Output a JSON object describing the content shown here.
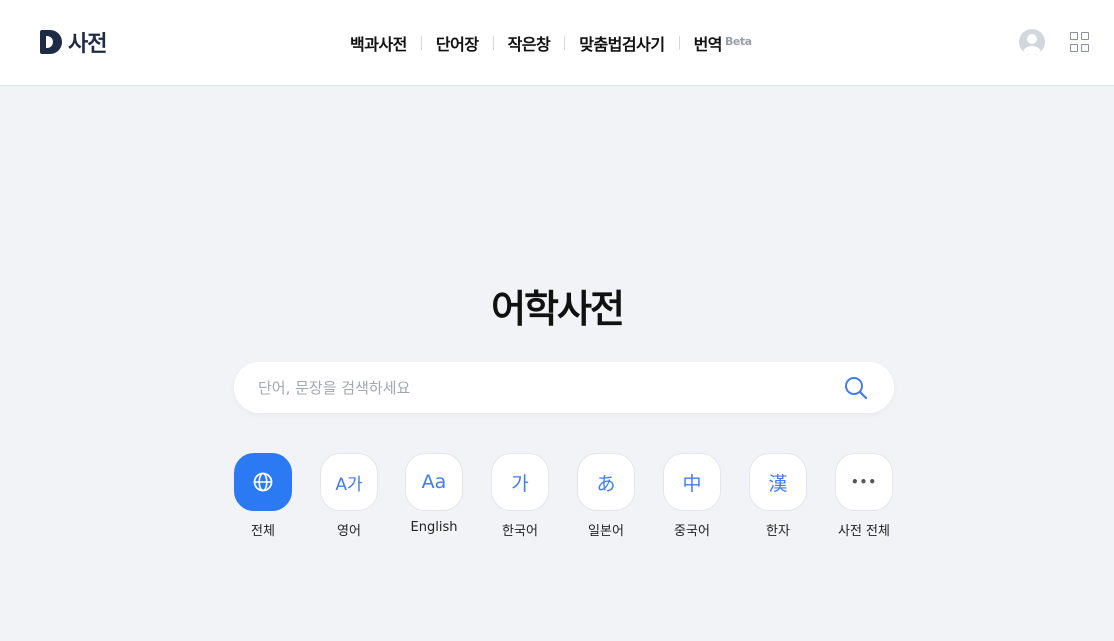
{
  "header": {
    "logo_text": "사전",
    "nav": [
      {
        "label": "백과사전"
      },
      {
        "label": "단어장"
      },
      {
        "label": "작은창"
      },
      {
        "label": "맞춤법검사기"
      },
      {
        "label": "번역",
        "badge": "Beta"
      }
    ]
  },
  "main": {
    "title": "어학사전",
    "search": {
      "placeholder": "단어, 문장을 검색하세요",
      "value": ""
    },
    "categories": [
      {
        "icon": "globe-icon",
        "glyph": "",
        "label": "전체",
        "active": true
      },
      {
        "icon": "english-translate-icon",
        "glyph": "A가",
        "label": "영어"
      },
      {
        "icon": "english-aa-icon",
        "glyph": "Aa",
        "label": "English"
      },
      {
        "icon": "korean-ga-icon",
        "glyph": "가",
        "label": "한국어"
      },
      {
        "icon": "japanese-a-icon",
        "glyph": "あ",
        "label": "일본어"
      },
      {
        "icon": "chinese-zhong-icon",
        "glyph": "中",
        "label": "중국어"
      },
      {
        "icon": "hanja-han-icon",
        "glyph": "漢",
        "label": "한자"
      },
      {
        "icon": "more-dots-icon",
        "glyph": "•••",
        "label": "사전 전체"
      }
    ]
  },
  "colors": {
    "accent": "#2b79f3",
    "background": "#f2f3f6",
    "icon_blue": "#3f7df0"
  }
}
